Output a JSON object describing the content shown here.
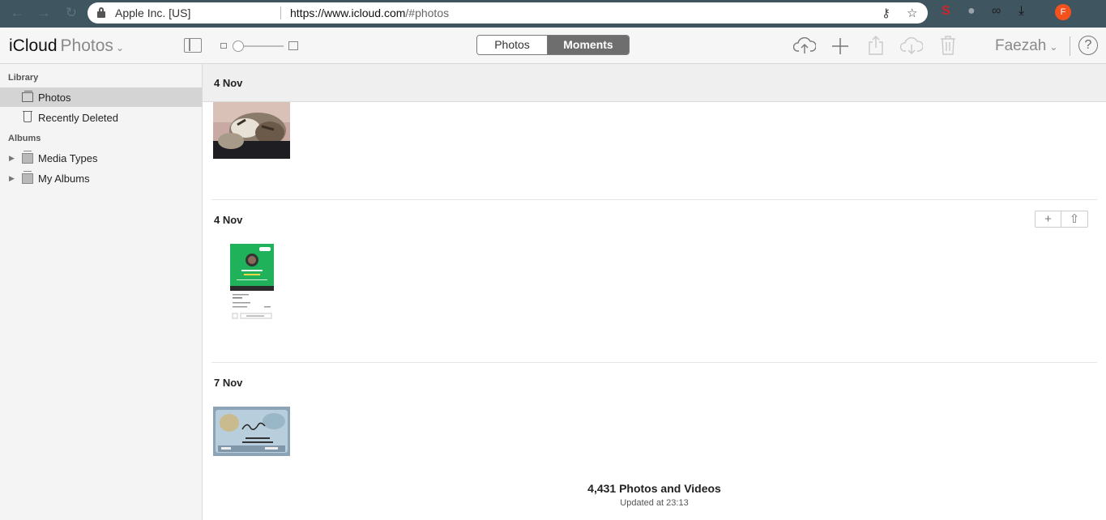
{
  "browser": {
    "org": "Apple Inc. [US]",
    "url_host": "https://www.icloud.com",
    "url_path": "/#photos",
    "profile_initial": "F"
  },
  "app": {
    "brand": "iCloud",
    "app_name": "Photos",
    "view_tabs": [
      {
        "label": "Photos",
        "selected": false
      },
      {
        "label": "Moments",
        "selected": true
      }
    ],
    "user_name": "Faezah",
    "help_glyph": "?",
    "colors": {
      "selected_tab": "#6e6e6e",
      "sidebar_selected": "#d4d4d4",
      "profile": "#f4511e"
    }
  },
  "sidebar": {
    "library_heading": "Library",
    "library_items": [
      {
        "label": "Photos",
        "icon": "photos-icon",
        "selected": true
      },
      {
        "label": "Recently Deleted",
        "icon": "trash-icon",
        "selected": false
      }
    ],
    "albums_heading": "Albums",
    "album_items": [
      {
        "label": "Media Types",
        "icon": "album-icon"
      },
      {
        "label": "My Albums",
        "icon": "album-icon"
      }
    ]
  },
  "moments": [
    {
      "date": "4 Nov",
      "photo": "cat-photo"
    },
    {
      "date": "4 Nov",
      "photo": "app-screenshot"
    },
    {
      "date": "7 Nov",
      "photo": "id-card-photo"
    }
  ],
  "footer": {
    "count_text": "4,431 Photos and Videos",
    "updated_text": "Updated at 23:13"
  }
}
